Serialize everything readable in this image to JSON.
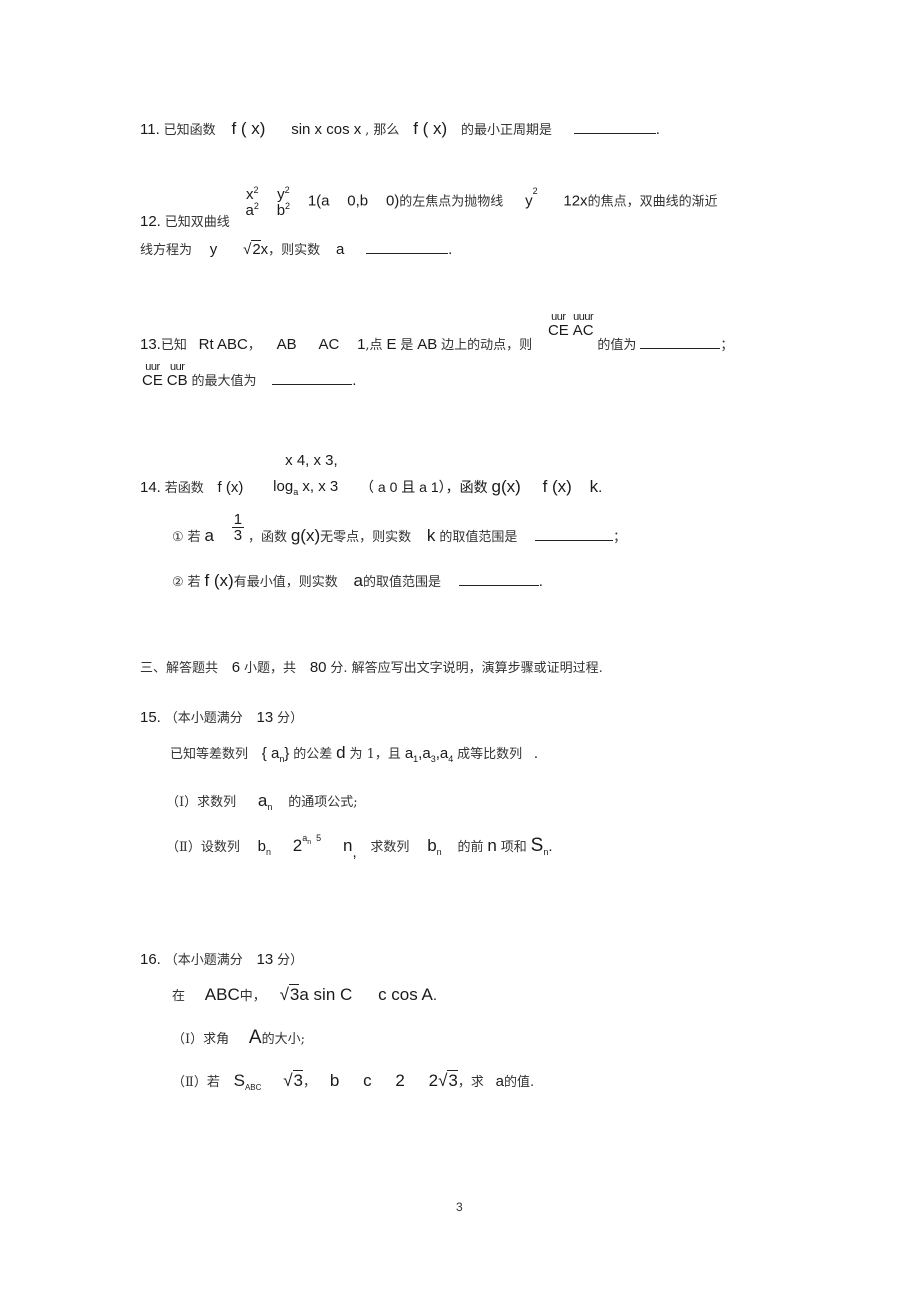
{
  "q11": {
    "num": "11.",
    "t1": "已知函数",
    "m1": "f ( x)",
    "m2": "sin x cos x",
    "t2": ", 那么",
    "m3": "f ( x)",
    "t3": "的最小正周期是",
    "end": "."
  },
  "q12": {
    "num": "12.",
    "t1": "已知双曲线",
    "x": "x",
    "a": "a",
    "y": "y",
    "b": "b",
    "sq": "2",
    "m1": "1(a",
    "m2": "0,b",
    "m3": "0)",
    "t2": "的左焦点为抛物线",
    "m4": "y",
    "m5": "12x",
    "t3": "的焦点，双曲线的渐近",
    "t4": "线方程为",
    "m6": "y",
    "m7": "2",
    "m8": "x",
    "t5": "，则实数",
    "m9": "a",
    "end": "."
  },
  "q13": {
    "num": "13.",
    "t1": "已知",
    "m1": "Rt  ABC",
    "t2": "，",
    "m2": "AB",
    "m3": "AC",
    "m4": "1",
    "t3": ",点",
    "m5": "E",
    "t4": "是",
    "m6": "AB",
    "t5": "边上的动点，则",
    "v1_arrow": "uur",
    "v1": "CE",
    "v2_arrow": "uuur",
    "v2": "AC",
    "t6": "的值为",
    "semi": "；",
    "v3_arrow": "uur",
    "v3": "CE",
    "v4_arrow": "uur",
    "v4": "CB",
    "t7": "的最大值为",
    "end": "."
  },
  "q14": {
    "num": "14.",
    "t1": "若函数",
    "m1": "f (x)",
    "p1": "x    4, x    3,",
    "p2_log": "log",
    "p2_base": "a",
    "p2_rest": "x, x    3",
    "m2": "（ a    0 且 a    1），函数",
    "m3": "g(x)",
    "m4": "f (x)",
    "m5": "k",
    "end": ".",
    "s1_mark": "①",
    "s1_t1": "若",
    "s1_m1": "a",
    "s1_num": "1",
    "s1_den": "3",
    "s1_t2": "，函数",
    "s1_m2": "g(x)",
    "s1_t3": "无零点，则实数",
    "s1_m3": "k",
    "s1_t4": "的取值范围是",
    "s1_end": "；",
    "s2_mark": "②",
    "s2_t1": "若",
    "s2_m1": "f (x)",
    "s2_t2": "有最小值，则实数",
    "s2_m2": "a",
    "s2_t3": "的取值范围是",
    "s2_end": "."
  },
  "section3": {
    "t1": "三、解答题共",
    "m1": "6",
    "t2": "小题，共",
    "m2": "80",
    "t3": "分. 解答应写出文字说明，演算步骤或证明过程."
  },
  "q15": {
    "num": "15.",
    "hdr1": "（本小题满分",
    "hdr_m": "13",
    "hdr2": "分）",
    "l1_t1": "已知等差数列",
    "l1_m1": "{ a",
    "l1_sub": "n",
    "l1_m2": "}",
    "l1_t2": "的公差",
    "l1_m3": "d",
    "l1_t3": "为 1，且",
    "l1_m4": "a",
    "l1_s1": "1",
    "l1_s3": "3",
    "l1_s4": "4",
    "l1_t4": "成等比数列",
    "l1_end": ".",
    "p1_label": "（Ⅰ）求数列",
    "p1_m": "a",
    "p1_sub": "n",
    "p1_t": "的通项公式;",
    "p2_label": "（Ⅱ）设数列",
    "p2_m1": "b",
    "p2_sub": "n",
    "p2_m2": "2",
    "p2_exp_a": "a",
    "p2_exp_n": "n",
    "p2_exp_5": "5",
    "p2_m3": "n",
    "p2_t1": "求数列",
    "p2_m4": "b",
    "p2_t2": "的前",
    "p2_m5": "n",
    "p2_t3": "项和",
    "p2_m6": "S",
    "p2_end": "."
  },
  "q16": {
    "num": "16.",
    "hdr1": "（本小题满分",
    "hdr_m": "13",
    "hdr2": "分）",
    "l1_t1": "在",
    "l1_m1": "ABC",
    "l1_t2": "中，",
    "l1_m2": "3",
    "l1_m3": "a sin C",
    "l1_m4": "c cos A",
    "l1_end": ".",
    "p1_label": "（Ⅰ）求角",
    "p1_m": "A",
    "p1_t": "的大小;",
    "p2_label": "（Ⅱ）若",
    "p2_m1": "S",
    "p2_sub": "ABC",
    "p2_m2": "3",
    "p2_t1": "，",
    "p2_m3": "b",
    "p2_m4": "c",
    "p2_m5": "2",
    "p2_m6": "2",
    "p2_m7": "3",
    "p2_t2": "，求",
    "p2_m8": "a",
    "p2_t3": "的值."
  },
  "page_number": "3"
}
